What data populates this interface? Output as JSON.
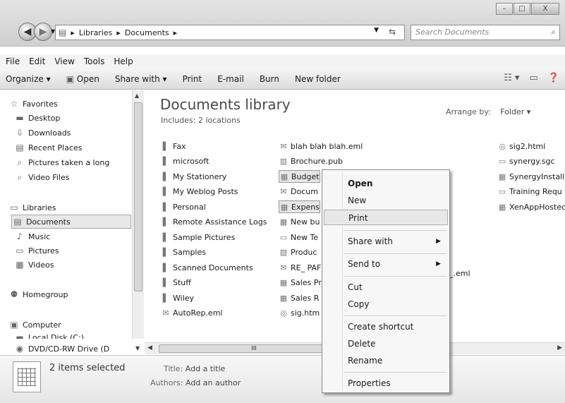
{
  "window": {
    "buttons": {
      "minimize": "–",
      "maximize": "□",
      "close": "X"
    }
  },
  "address": {
    "segments": [
      "▸",
      "Libraries",
      "▸",
      "Documents",
      "▸"
    ],
    "search_placeholder": "Search Documents"
  },
  "menubar": [
    "File",
    "Edit",
    "View",
    "Tools",
    "Help"
  ],
  "commandbar": [
    "Organize ▾",
    "Open",
    "Share with ▾",
    "Print",
    "E-mail",
    "Burn",
    "New folder"
  ],
  "navpane": {
    "items": [
      {
        "label": "Favorites",
        "icon": "star-icon"
      },
      {
        "label": "Desktop",
        "icon": "desktop-icon"
      },
      {
        "label": "Downloads",
        "icon": "downloads-icon"
      },
      {
        "label": "Recent Places",
        "icon": "recent-places-icon"
      },
      {
        "label": "Pictures taken a long",
        "icon": "search-folder-icon"
      },
      {
        "label": "Video Files",
        "icon": "search-folder-icon"
      },
      {
        "label": "Libraries",
        "icon": "libraries-icon"
      },
      {
        "label": "Documents",
        "icon": "documents-icon"
      },
      {
        "label": "Music",
        "icon": "music-icon"
      },
      {
        "label": "Pictures",
        "icon": "pictures-icon"
      },
      {
        "label": "Videos",
        "icon": "videos-icon"
      },
      {
        "label": "Homegroup",
        "icon": "homegroup-icon"
      },
      {
        "label": "Computer",
        "icon": "computer-icon"
      },
      {
        "label": "Local Disk (C:)",
        "icon": "disk-icon"
      },
      {
        "label": "DVD/CD-RW Drive (D",
        "icon": "dvd-icon"
      }
    ]
  },
  "content": {
    "title": "Documents library",
    "subtitle": "Includes: 2 locations",
    "arrange_label": "Arrange by:",
    "arrange_value": "Folder ▾",
    "col1": [
      "Fax",
      "microsoft",
      "My Stationery",
      "My Weblog Posts",
      "Personal",
      "Remote Assistance Logs",
      "Sample Pictures",
      "Samples",
      "Scanned Documents",
      "Stuff",
      "Wiley",
      "AutoRep.eml"
    ],
    "col2": [
      "blah blah blah.eml",
      "Brochure.pub",
      "Budget",
      "Docum",
      "Expens",
      "New bu",
      "New Te",
      "Produc",
      "RE_ PAF",
      "Sales Pr",
      "Sales R",
      "sig.htm"
    ],
    "col2_extra": "arn_.eml",
    "col3": [
      "sig2.html",
      "synergy.sgc",
      "SynergyInstall",
      "Training Requ",
      "XenAppHostec"
    ]
  },
  "context_menu": {
    "items": [
      "Open",
      "New",
      "Print",
      "Share with",
      "Send to",
      "Cut",
      "Copy",
      "Create shortcut",
      "Delete",
      "Rename",
      "Properties"
    ]
  },
  "details": {
    "selected": "2 items selected",
    "title_key": "Title:",
    "title_val": "Add a title",
    "authors_key": "Authors:",
    "authors_val": "Add an author"
  },
  "hscroll_thumb": "III"
}
